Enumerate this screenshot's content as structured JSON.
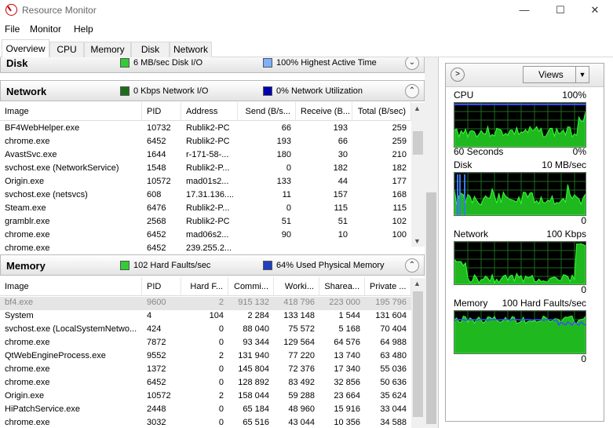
{
  "window": {
    "title": "Resource Monitor",
    "minimize_label": "—",
    "maximize_label": "☐",
    "close_label": "✕"
  },
  "menu": [
    "File",
    "Monitor",
    "Help"
  ],
  "tabs": [
    "Overview",
    "CPU",
    "Memory",
    "Disk",
    "Network"
  ],
  "disk": {
    "title": "Disk",
    "io_text": "6 MB/sec Disk I/O",
    "active_text": "100% Highest Active Time",
    "io_color": "#33cc33",
    "active_color": "#7fb0ff"
  },
  "network": {
    "title": "Network",
    "io_text": "0 Kbps Network I/O",
    "util_text": "0% Network Utilization",
    "io_color": "#1a6e1a",
    "util_color": "#0000b0",
    "columns": [
      "Image",
      "PID",
      "Address",
      "Send (B/s...",
      "Receive (B...",
      "Total (B/sec)"
    ],
    "rows": [
      [
        "BF4WebHelper.exe",
        "10732",
        "Rublik2-PC",
        "66",
        "193",
        "259"
      ],
      [
        "chrome.exe",
        "6452",
        "Rublik2-PC",
        "193",
        "66",
        "259"
      ],
      [
        "AvastSvc.exe",
        "1644",
        "r-171-58-...",
        "180",
        "30",
        "210"
      ],
      [
        "svchost.exe (NetworkService)",
        "1548",
        "Rublik2-P...",
        "0",
        "182",
        "182"
      ],
      [
        "Origin.exe",
        "10572",
        "mad01s2...",
        "133",
        "44",
        "177"
      ],
      [
        "svchost.exe (netsvcs)",
        "608",
        "17.31.136....",
        "11",
        "157",
        "168"
      ],
      [
        "Steam.exe",
        "6476",
        "Rublik2-P...",
        "0",
        "115",
        "115"
      ],
      [
        "gramblr.exe",
        "2568",
        "Rublik2-PC",
        "51",
        "51",
        "102"
      ],
      [
        "chrome.exe",
        "6452",
        "mad06s2...",
        "90",
        "10",
        "100"
      ],
      [
        "chrome.exe",
        "6452",
        "239.255.2...",
        "",
        "",
        ""
      ]
    ]
  },
  "memory": {
    "title": "Memory",
    "faults_text": "102 Hard Faults/sec",
    "used_text": "64% Used Physical Memory",
    "faults_color": "#33cc33",
    "used_color": "#2040c0",
    "columns": [
      "Image",
      "PID",
      "Hard F...",
      "Commi...",
      "Worki...",
      "Sharea...",
      "Private ..."
    ],
    "rows": [
      [
        "bf4.exe",
        "9600",
        "2",
        "915 132",
        "418 796",
        "223 000",
        "195 796"
      ],
      [
        "System",
        "4",
        "104",
        "2 284",
        "133 148",
        "1 544",
        "131 604"
      ],
      [
        "svchost.exe (LocalSystemNetwo...",
        "424",
        "0",
        "88 040",
        "75 572",
        "5 168",
        "70 404"
      ],
      [
        "chrome.exe",
        "7872",
        "0",
        "93 344",
        "129 564",
        "64 576",
        "64 988"
      ],
      [
        "QtWebEngineProcess.exe",
        "9552",
        "2",
        "131 940",
        "77 220",
        "13 740",
        "63 480"
      ],
      [
        "chrome.exe",
        "1372",
        "0",
        "145 804",
        "72 376",
        "17 340",
        "55 036"
      ],
      [
        "chrome.exe",
        "6452",
        "0",
        "128 892",
        "83 492",
        "32 856",
        "50 636"
      ],
      [
        "Origin.exe",
        "10572",
        "2",
        "158 044",
        "59 288",
        "23 664",
        "35 624"
      ],
      [
        "HiPatchService.exe",
        "2448",
        "0",
        "65 184",
        "48 960",
        "15 916",
        "33 044"
      ],
      [
        "chrome.exe",
        "3032",
        "0",
        "65 516",
        "43 044",
        "10 356",
        "34 588"
      ]
    ]
  },
  "views": {
    "button_label": "Views",
    "graphs": [
      {
        "name": "CPU",
        "max": "100%",
        "min": "0%",
        "time": "60 Seconds"
      },
      {
        "name": "Disk",
        "max": "10 MB/sec",
        "min": "0"
      },
      {
        "name": "Network",
        "max": "100 Kbps",
        "min": "0"
      },
      {
        "name": "Memory",
        "max": "100 Hard Faults/sec",
        "min": "0"
      }
    ]
  }
}
